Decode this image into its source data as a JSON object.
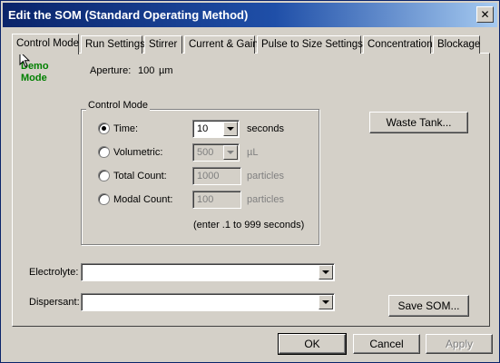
{
  "window": {
    "title": "Edit the SOM (Standard Operating Method)",
    "close_glyph": "✕"
  },
  "tabs": [
    {
      "label": "Control Mode"
    },
    {
      "label": "Run Settings"
    },
    {
      "label": "Stirrer"
    },
    {
      "label": "Current & Gain"
    },
    {
      "label": "Pulse to Size Settings"
    },
    {
      "label": "Concentration"
    },
    {
      "label": "Blockage"
    }
  ],
  "active_tab": "Control Mode",
  "demo_mode": {
    "line1": "Demo",
    "line2": "Mode",
    "color": "#008000"
  },
  "aperture": {
    "label": "Aperture:",
    "value": "100",
    "unit": "µm"
  },
  "control_mode": {
    "group_title": "Control Mode",
    "options": [
      {
        "label": "Time:",
        "value": "10",
        "unit": "seconds",
        "selected": true,
        "has_dropdown": true,
        "enabled": true
      },
      {
        "label": "Volumetric:",
        "value": "500",
        "unit": "µL",
        "selected": false,
        "has_dropdown": true,
        "enabled": false
      },
      {
        "label": "Total Count:",
        "value": "1000",
        "unit": "particles",
        "selected": false,
        "has_dropdown": false,
        "enabled": false
      },
      {
        "label": "Modal Count:",
        "value": "100",
        "unit": "particles",
        "selected": false,
        "has_dropdown": false,
        "enabled": false
      }
    ],
    "hint": "(enter .1 to 999 seconds)"
  },
  "waste_tank_button": "Waste Tank...",
  "electrolyte": {
    "label": "Electrolyte:",
    "value": ""
  },
  "dispersant": {
    "label": "Dispersant:",
    "value": ""
  },
  "save_som_button": "Save SOM...",
  "footer": {
    "ok": "OK",
    "cancel": "Cancel",
    "apply": "Apply"
  },
  "icons": {
    "close": "close-icon",
    "cursor": "mouse-pointer-icon",
    "dropdown": "chevron-down-icon"
  }
}
